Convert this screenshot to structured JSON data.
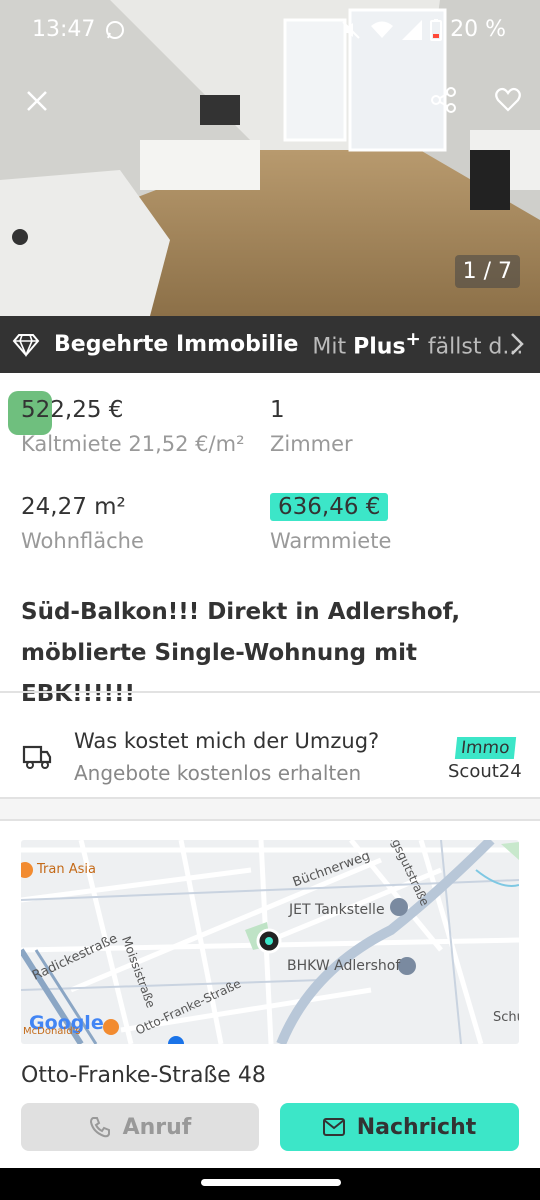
{
  "status_bar": {
    "time": "13:47",
    "battery": "20 %",
    "whatsapp_icon": "whatsapp-icon",
    "mute_icon": "mute-icon",
    "wifi_icon": "wifi-icon",
    "signal_icon": "signal-icon",
    "battery_icon": "battery-icon"
  },
  "gallery": {
    "counter": "1 / 7",
    "close_icon": "close-icon",
    "share_icon": "share-icon",
    "favorite_icon": "heart-icon"
  },
  "banner": {
    "label": "Begehrte Immobilie",
    "promo_prefix": "Mit ",
    "promo_brand": "Plus",
    "promo_plus": "+",
    "promo_suffix": " fällst d...",
    "icon": "diamond-icon"
  },
  "facts": {
    "cold_rent_value": "522,25 €",
    "cold_rent_label": "Kaltmiete 21,52 €/m²",
    "rooms_value": "1",
    "rooms_label": "Zimmer",
    "area_value": "24,27 m²",
    "area_label": "Wohnfläche",
    "warm_rent_value": "636,46 €",
    "warm_rent_label": "Warmmiete"
  },
  "title": "Süd-Balkon!!! Direkt in Adlershof, möblierte Single-Wohnung mit EBK!!!!!!",
  "moving": {
    "question": "Was kostet mich der Umzug?",
    "subtitle": "Angebote kostenlos erhalten",
    "logo_top": "Immo",
    "logo_bottom": "Scout24",
    "icon": "truck-icon"
  },
  "map": {
    "labels": {
      "tran_asia": "Tran Asia",
      "buechnerweg": "Büchnerweg",
      "jet": "JET Tankstelle",
      "radicke": "Radickestraße",
      "moissi": "Moissistraße",
      "bhkw": "BHKW Adlershof",
      "otto_franke": "Otto-Franke-Straße",
      "google": "Google",
      "mcdonalds": "McDonald's",
      "schu": "Schu",
      "ngutstrasse": "ngsgutstraße"
    }
  },
  "address": "Otto-Franke-Straße 48",
  "actions": {
    "call": "Anruf",
    "message": "Nachricht",
    "phone_icon": "phone-icon",
    "mail_icon": "mail-icon"
  }
}
